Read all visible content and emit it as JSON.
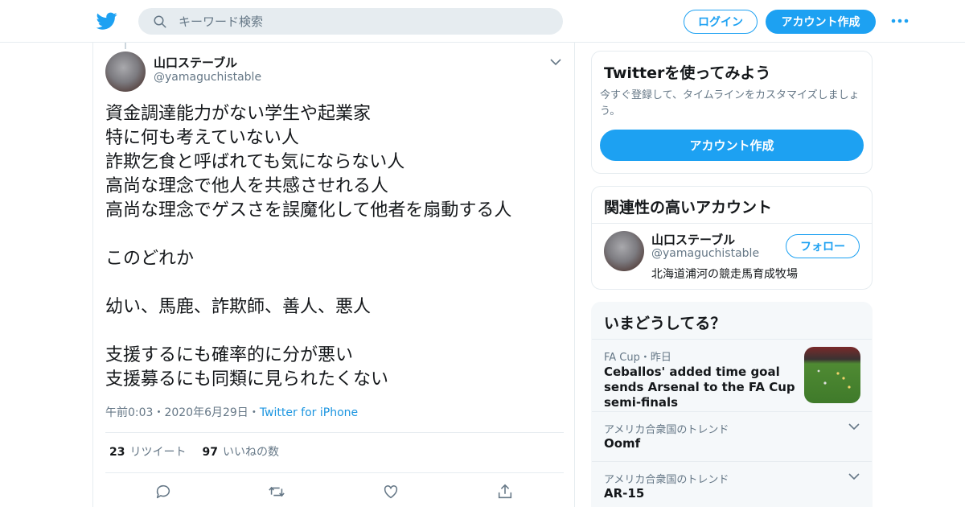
{
  "header": {
    "search_placeholder": "キーワード検索",
    "login_label": "ログイン",
    "signup_label": "アカウント作成"
  },
  "tweet": {
    "author_name": "山口ステーブル",
    "author_handle": "@yamaguchistable",
    "text": "資金調達能力がない学生や起業家\n特に何も考えていない人\n詐欺乞食と呼ばれても気にならない人\n高尚な理念で他人を共感させれる人\n高尚な理念でゲスさを誤魔化して他者を扇動する人\n\nこのどれか\n\n幼い、馬鹿、詐欺師、善人、悪人\n\n支援するにも確率的に分が悪い\n支援募るにも同類に見られたくない",
    "time": "午前0:03",
    "date": "2020年6月29日",
    "separator": "・",
    "source": "Twitter for iPhone",
    "retweet_count": "23",
    "retweet_label": "リツイート",
    "like_count": "97",
    "like_label": "いいねの数"
  },
  "signup_card": {
    "title": "Twitterを使ってみよう",
    "description": "今すぐ登録して、タイムラインをカスタマイズしましょう。",
    "button_label": "アカウント作成"
  },
  "related": {
    "title": "関連性の高いアカウント",
    "account": {
      "name": "山口ステーブル",
      "handle": "@yamaguchistable",
      "bio": "北海道浦河の競走馬育成牧場",
      "follow_label": "フォロー"
    }
  },
  "trends": {
    "title": "いまどうしてる？",
    "items": [
      {
        "meta": "FA Cup・昨日",
        "title": "Ceballos' added time goal sends Arsenal to the FA Cup semi-finals"
      },
      {
        "meta": "アメリカ合衆国のトレンド",
        "title": "Oomf"
      },
      {
        "meta": "アメリカ合衆国のトレンド",
        "title": "AR-15"
      }
    ]
  },
  "colors": {
    "brand": "#1da1f2",
    "secondary_text": "#657786",
    "border": "#e6ecf0"
  }
}
